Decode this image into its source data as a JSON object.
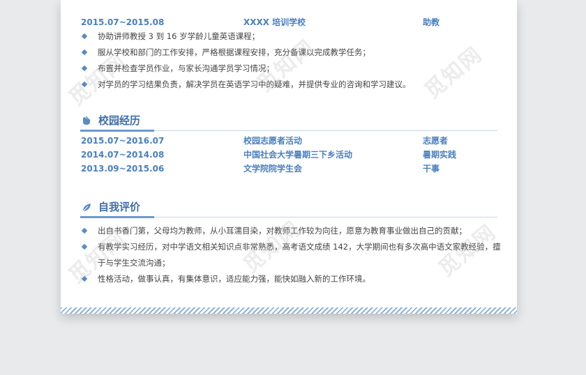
{
  "work": {
    "period": "2015.07~2015.08",
    "org": "XXXX 培训学校",
    "role": "助教",
    "duties": [
      "协助讲师教授 3 到 16 岁学龄儿童英语课程；",
      "服从学校和部门的工作安排，严格根据课程安排，充分备课以完成教学任务；",
      "布置并检查学员作业，与家长沟通学员学习情况；",
      "对学员的学习结果负责，解决学员在英语学习中的疑难，并提供专业的咨询和学习建议。"
    ]
  },
  "campus": {
    "title": "校园经历",
    "icon": "mouse-icon",
    "rows": [
      {
        "period": "2015.07~2016.07",
        "org": "校园志愿者活动",
        "role": "志愿者"
      },
      {
        "period": "2014.07~2014.08",
        "org": "中国社会大学暑期三下乡活动",
        "role": "暑期实践"
      },
      {
        "period": "2013.09~2015.06",
        "org": "文学院院学生会",
        "role": "干事"
      }
    ]
  },
  "self": {
    "title": "自我评价",
    "icon": "leaf-icon",
    "items": [
      "出自书香门第，父母均为教师，从小耳濡目染，对教师工作较为向往，愿意为教育事业做出自己的贡献；",
      "有教学实习经历，对中学语文相关知识点非常熟悉，高考语文成绩 142，大学期间也有多次高中语文家教经验，擅于与学生交流沟通；",
      "性格活动，做事认真，有集体意识，适应能力强，能快如融入新的工作环境。"
    ]
  },
  "watermark": "觅知网",
  "colors": {
    "accent": "#4a7fc0",
    "title": "#3f6ea9",
    "bullet": "#5b8ac6"
  }
}
